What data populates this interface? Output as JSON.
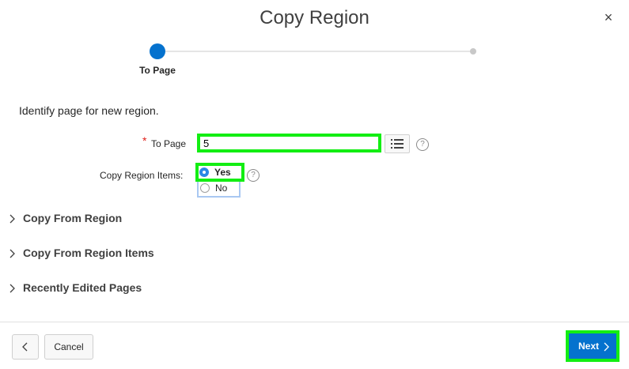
{
  "dialog": {
    "title": "Copy Region",
    "close_glyph": "×"
  },
  "wizard": {
    "active_step_label": "To Page"
  },
  "instructions": "Identify page for new region.",
  "form": {
    "to_page": {
      "label": "To Page",
      "required_marker": "*",
      "value": "5",
      "lov_icon": "list-icon",
      "help_glyph": "?"
    },
    "copy_region_items": {
      "label": "Copy Region Items:",
      "options": [
        {
          "label": "Yes",
          "checked": true
        },
        {
          "label": "No",
          "checked": false
        }
      ],
      "help_glyph": "?"
    }
  },
  "sections": [
    {
      "label": "Copy From Region"
    },
    {
      "label": "Copy From Region Items"
    },
    {
      "label": "Recently Edited Pages"
    }
  ],
  "footer": {
    "back_icon": "chevron-left-icon",
    "cancel_label": "Cancel",
    "next_label": "Next",
    "next_icon": "chevron-right-icon"
  },
  "colors": {
    "accent": "#0572ce",
    "highlight": "#13ee13",
    "required": "#e0201b"
  }
}
